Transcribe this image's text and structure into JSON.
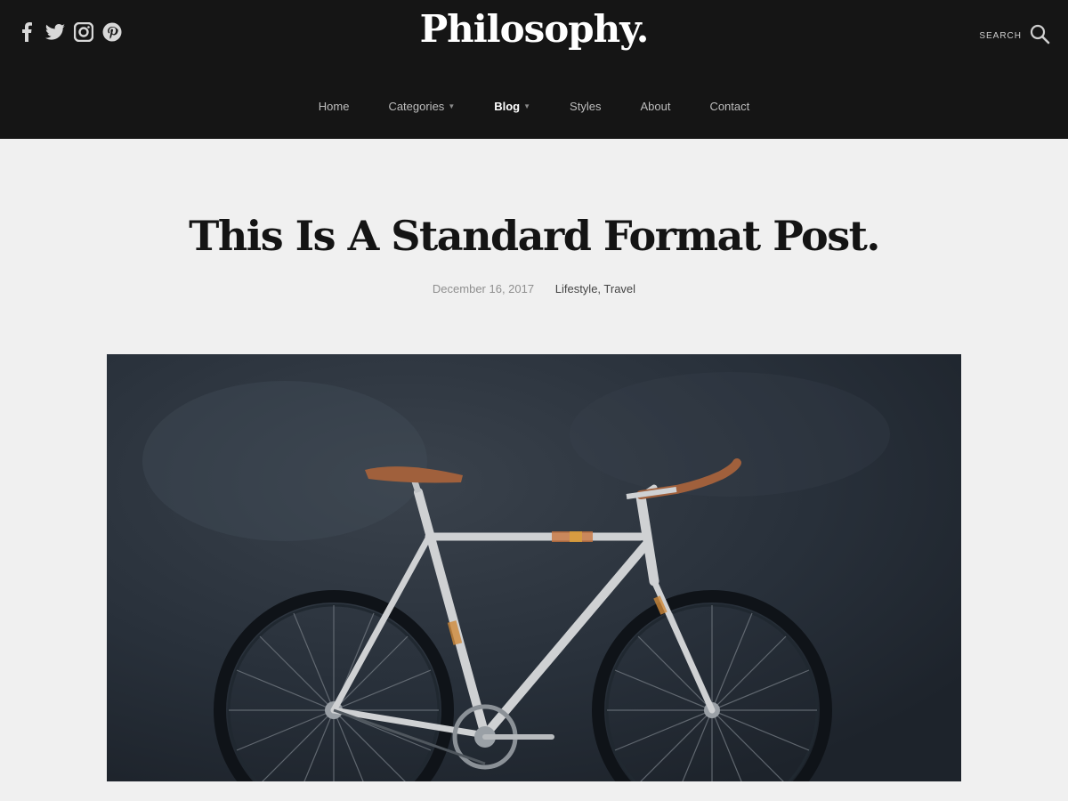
{
  "header": {
    "site_title": "Philosophy.",
    "search_label": "SEARCH",
    "social_icons": [
      "facebook-icon",
      "twitter-icon",
      "instagram-icon",
      "pinterest-icon"
    ],
    "background": "#151515"
  },
  "nav": {
    "items": [
      {
        "label": "Home",
        "has_dropdown": false,
        "active": false
      },
      {
        "label": "Categories",
        "has_dropdown": true,
        "active": false
      },
      {
        "label": "Blog",
        "has_dropdown": true,
        "active": true
      },
      {
        "label": "Styles",
        "has_dropdown": false,
        "active": false
      },
      {
        "label": "About",
        "has_dropdown": false,
        "active": false
      },
      {
        "label": "Contact",
        "has_dropdown": false,
        "active": false
      }
    ]
  },
  "post": {
    "title": "This Is A Standard Format Post.",
    "date": "December 16, 2017",
    "categories": "Lifestyle, Travel",
    "image_icon": "bicycle-photo"
  },
  "colors": {
    "page_background": "#f0f0f0",
    "title_color": "#141414",
    "saddle_brown": "#a0603c"
  }
}
